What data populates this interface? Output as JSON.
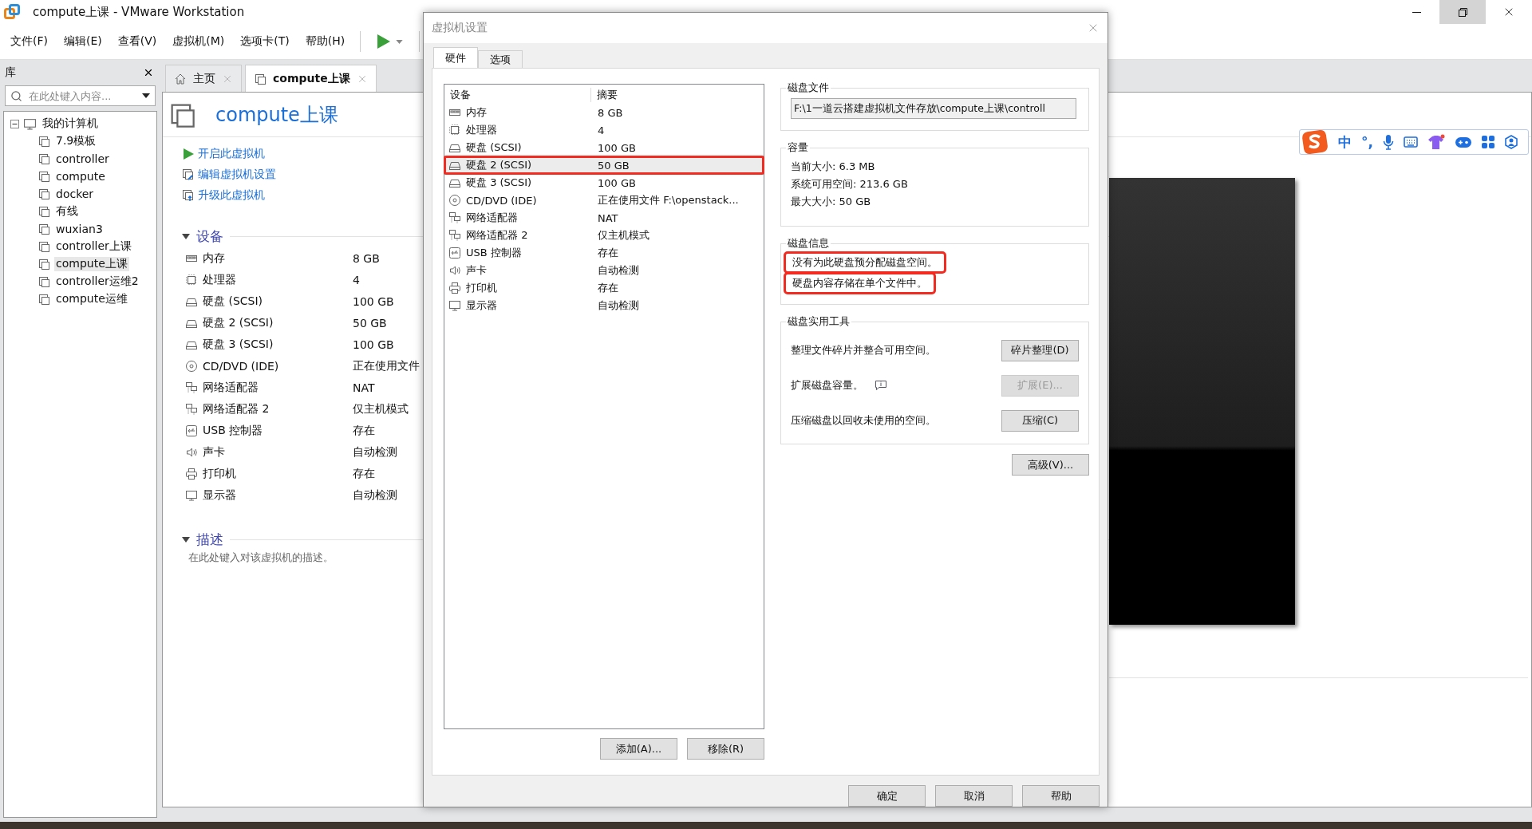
{
  "window": {
    "title": "compute上课 - VMware Workstation"
  },
  "menu": [
    "文件(F)",
    "编辑(E)",
    "查看(V)",
    "虚拟机(M)",
    "选项卡(T)",
    "帮助(H)"
  ],
  "library": {
    "title": "库",
    "search": {
      "placeholder": "在此处键入内容..."
    },
    "tree": [
      {
        "label": "我的计算机",
        "expanded": true,
        "selected": false,
        "children": [
          {
            "label": "7.9模板",
            "selected": false
          },
          {
            "label": "controller",
            "selected": false
          },
          {
            "label": "compute",
            "selected": false
          },
          {
            "label": "docker",
            "selected": false
          },
          {
            "label": "有线",
            "selected": false
          },
          {
            "label": "wuxian3",
            "selected": false
          },
          {
            "label": "controller上课",
            "selected": false
          },
          {
            "label": "compute上课",
            "selected": true
          },
          {
            "label": "controller运维2",
            "selected": false
          },
          {
            "label": "compute运维",
            "selected": false
          }
        ]
      }
    ]
  },
  "tabs": [
    {
      "label": "主页",
      "kind": "home",
      "selected": false
    },
    {
      "label": "compute上课",
      "kind": "vm",
      "selected": true
    }
  ],
  "vm": {
    "name": "compute上课",
    "actions": [
      {
        "label": "开启此虚拟机",
        "kind": "power"
      },
      {
        "label": "编辑虚拟机设置",
        "kind": "edit"
      },
      {
        "label": "升级此虚拟机",
        "kind": "upgrade"
      }
    ],
    "devices_section": {
      "title": "设备",
      "expanded": true,
      "devices": [
        {
          "kind": "memory",
          "name": "内存",
          "summary": "8 GB"
        },
        {
          "kind": "cpu",
          "name": "处理器",
          "summary": "4"
        },
        {
          "kind": "disk",
          "name": "硬盘 (SCSI)",
          "summary": "100 GB"
        },
        {
          "kind": "disk",
          "name": "硬盘 2 (SCSI)",
          "summary": "50 GB"
        },
        {
          "kind": "disk",
          "name": "硬盘 3 (SCSI)",
          "summary": "100 GB"
        },
        {
          "kind": "cd",
          "name": "CD/DVD (IDE)",
          "summary": "正在使用文件"
        },
        {
          "kind": "network",
          "name": "网络适配器",
          "summary": "NAT"
        },
        {
          "kind": "network",
          "name": "网络适配器 2",
          "summary": "仅主机模式"
        },
        {
          "kind": "usb",
          "name": "USB 控制器",
          "summary": "存在"
        },
        {
          "kind": "sound",
          "name": "声卡",
          "summary": "自动检测"
        },
        {
          "kind": "printer",
          "name": "打印机",
          "summary": "存在"
        },
        {
          "kind": "display",
          "name": "显示器",
          "summary": "自动检测"
        }
      ]
    },
    "description_section": {
      "title": "描述",
      "expanded": true,
      "placeholder": "在此处键入对该虚拟机的描述。"
    }
  },
  "ime": [
    {
      "kind": "logo"
    },
    {
      "kind": "text",
      "text": "中"
    },
    {
      "kind": "text",
      "text": "°,"
    },
    {
      "kind": "mic"
    },
    {
      "kind": "keyboard"
    },
    {
      "kind": "shirt"
    },
    {
      "kind": "gamepad"
    },
    {
      "kind": "apps"
    },
    {
      "kind": "figure"
    }
  ],
  "dialog": {
    "title": "虚拟机设置",
    "tabs": [
      {
        "label": "硬件",
        "selected": true
      },
      {
        "label": "选项",
        "selected": false
      }
    ],
    "columns": [
      "设备",
      "摘要"
    ],
    "devices": [
      {
        "kind": "memory",
        "name": "内存",
        "summary": "8 GB",
        "selected": false,
        "highlighted": false
      },
      {
        "kind": "cpu",
        "name": "处理器",
        "summary": "4",
        "selected": false,
        "highlighted": false
      },
      {
        "kind": "disk",
        "name": "硬盘 (SCSI)",
        "summary": "100 GB",
        "selected": false,
        "highlighted": false
      },
      {
        "kind": "disk",
        "name": "硬盘 2 (SCSI)",
        "summary": "50 GB",
        "selected": true,
        "highlighted": true
      },
      {
        "kind": "disk",
        "name": "硬盘 3 (SCSI)",
        "summary": "100 GB",
        "selected": false,
        "highlighted": false
      },
      {
        "kind": "cd",
        "name": "CD/DVD (IDE)",
        "summary": "正在使用文件 F:\\openstack...",
        "selected": false,
        "highlighted": false
      },
      {
        "kind": "network",
        "name": "网络适配器",
        "summary": "NAT",
        "selected": false,
        "highlighted": false
      },
      {
        "kind": "network",
        "name": "网络适配器 2",
        "summary": "仅主机模式",
        "selected": false,
        "highlighted": false
      },
      {
        "kind": "usb",
        "name": "USB 控制器",
        "summary": "存在",
        "selected": false,
        "highlighted": false
      },
      {
        "kind": "sound",
        "name": "声卡",
        "summary": "自动检测",
        "selected": false,
        "highlighted": false
      },
      {
        "kind": "printer",
        "name": "打印机",
        "summary": "存在",
        "selected": false,
        "highlighted": false
      },
      {
        "kind": "display",
        "name": "显示器",
        "summary": "自动检测",
        "selected": false,
        "highlighted": false
      }
    ],
    "list_buttons": [
      "添加(A)...",
      "移除(R)"
    ],
    "disk_file": {
      "title": "磁盘文件",
      "value": "F:\\1一道云搭建虚拟机文件存放\\compute上课\\controll"
    },
    "capacity": {
      "title": "容量",
      "lines": [
        "当前大小: 6.3 MB",
        "系统可用空间: 213.6 GB",
        "最大大小: 50 GB"
      ]
    },
    "disk_info": {
      "title": "磁盘信息",
      "lines": [
        {
          "text": "没有为此硬盘预分配磁盘空间。",
          "highlighted": true
        },
        {
          "text": "硬盘内容存储在单个文件中。",
          "highlighted": true
        }
      ]
    },
    "utilities": {
      "title": "磁盘实用工具",
      "rows": [
        {
          "text": "整理文件碎片并整合可用空间。",
          "button": "碎片整理(D)",
          "disabled": false,
          "info": false
        },
        {
          "text": "扩展磁盘容量。",
          "button": "扩展(E)...",
          "disabled": true,
          "info": true
        },
        {
          "text": "压缩磁盘以回收未使用的空间。",
          "button": "压缩(C)",
          "disabled": false,
          "info": false
        }
      ]
    },
    "advanced_button": "高级(V)...",
    "footer_buttons": [
      "确定",
      "取消",
      "帮助"
    ]
  }
}
